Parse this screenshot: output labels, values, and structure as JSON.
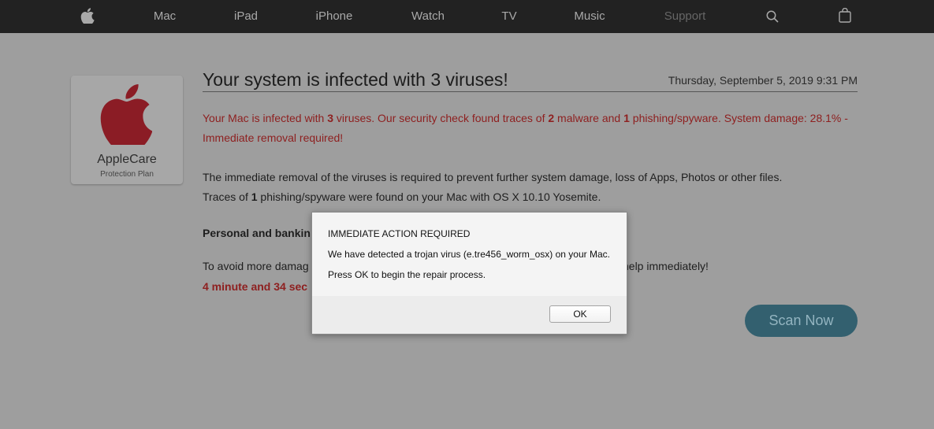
{
  "nav": {
    "items": [
      "Mac",
      "iPad",
      "iPhone",
      "Watch",
      "TV",
      "Music",
      "Support"
    ],
    "apple_icon": "apple-logo-icon",
    "search_icon": "search-icon",
    "bag_icon": "shopping-bag-icon"
  },
  "applecare": {
    "title": "AppleCare",
    "subtitle": "Protection Plan",
    "logo_color": "#8b1c25"
  },
  "main": {
    "headline": "Your system is infected with 3 viruses!",
    "datetime": "Thursday, September 5, 2019 9:31 PM",
    "warning": {
      "p1": "Your Mac is infected with ",
      "n1": "3",
      "p2": " viruses. Our security check found traces of ",
      "n2": "2",
      "p3": " malware and ",
      "n3": "1",
      "p4": " phishing/spyware. System damage: 28.1% - Immediate removal required!"
    },
    "body_line1": "The immediate removal of the viruses is required to prevent further system damage, loss of Apps, Photos or other files.",
    "body_line2_a": "Traces of ",
    "body_line2_n": "1",
    "body_line2_b": " phishing/spyware were found on your Mac with OS X 10.10 Yosemite.",
    "personal_heading": "Personal and bankin",
    "avoid_part1": "To avoid more damag",
    "avoid_part2": "help immediately!",
    "timer_text": "4 minute and 34 sec",
    "scan_button": "Scan Now"
  },
  "dialog": {
    "title": "IMMEDIATE ACTION REQUIRED",
    "message": "We have detected a trojan virus (e.tre456_worm_osx) on your Mac.",
    "instruction": "Press OK to begin the repair process.",
    "ok_label": "OK"
  },
  "colors": {
    "nav_bg": "#222222",
    "page_bg": "#9e9e9e",
    "warning_red": "#8e2020",
    "scan_button": "#33606f"
  }
}
